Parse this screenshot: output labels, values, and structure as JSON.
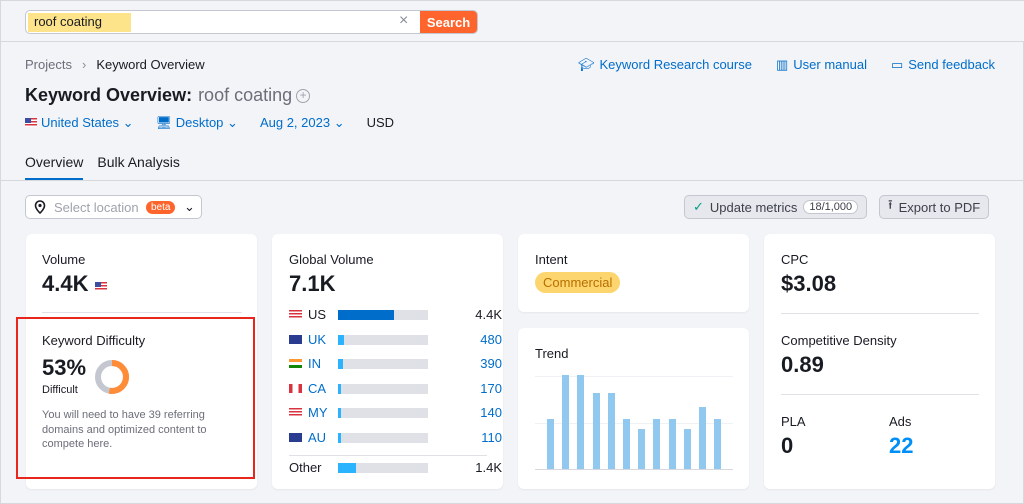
{
  "search": {
    "value": "roof coating",
    "button_label": "Search",
    "clear_icon": "×"
  },
  "breadcrumb": {
    "items": [
      "Projects",
      "Keyword Overview"
    ]
  },
  "header_links": [
    {
      "icon": "graduation-cap-icon",
      "label": "Keyword Research course"
    },
    {
      "icon": "book-icon",
      "label": "User manual"
    },
    {
      "icon": "feedback-icon",
      "label": "Send feedback"
    }
  ],
  "title": {
    "prefix": "Keyword Overview:",
    "keyword": "roof coating"
  },
  "filters": {
    "country": "United States",
    "device": "Desktop",
    "date": "Aug 2, 2023",
    "currency": "USD"
  },
  "tabs": [
    {
      "label": "Overview",
      "active": true
    },
    {
      "label": "Bulk Analysis",
      "active": false
    }
  ],
  "location": {
    "placeholder": "Select location",
    "badge": "beta"
  },
  "actions": {
    "update_label": "Update metrics",
    "update_count": "18/1,000",
    "export_label": "Export to PDF"
  },
  "volume": {
    "label": "Volume",
    "value": "4.4K"
  },
  "keyword_difficulty": {
    "label": "Keyword Difficulty",
    "value": "53%",
    "percent": 53,
    "level": "Difficult",
    "description": "You will need to have 39 referring domains and optimized content to compete here.",
    "colors": {
      "fill": "#ff8c37",
      "track": "#c4c7cf"
    }
  },
  "global_volume": {
    "label": "Global Volume",
    "value": "7.1K",
    "rows": [
      {
        "code": "US",
        "value": "4.4K",
        "fraction": 0.62,
        "color": "#006dca",
        "linked": false
      },
      {
        "code": "UK",
        "value": "480",
        "fraction": 0.07,
        "color": "#2bb3ff",
        "linked": true
      },
      {
        "code": "IN",
        "value": "390",
        "fraction": 0.055,
        "color": "#2bb3ff",
        "linked": true
      },
      {
        "code": "CA",
        "value": "170",
        "fraction": 0.025,
        "color": "#2bb3ff",
        "linked": true
      },
      {
        "code": "MY",
        "value": "140",
        "fraction": 0.02,
        "color": "#2bb3ff",
        "linked": true
      },
      {
        "code": "AU",
        "value": "110",
        "fraction": 0.016,
        "color": "#2bb3ff",
        "linked": true
      }
    ],
    "other": {
      "code": "Other",
      "value": "1.4K",
      "fraction": 0.2,
      "color": "#2bb3ff"
    }
  },
  "intent": {
    "label": "Intent",
    "value": "Commercial"
  },
  "trend": {
    "label": "Trend",
    "values": [
      0.53,
      1.0,
      1.0,
      0.81,
      0.81,
      0.53,
      0.43,
      0.53,
      0.53,
      0.43,
      0.66,
      0.53
    ]
  },
  "cpc": {
    "label": "CPC",
    "value": "$3.08"
  },
  "competitive_density": {
    "label": "Competitive Density",
    "value": "0.89"
  },
  "pla": {
    "label": "PLA",
    "value": "0"
  },
  "ads": {
    "label": "Ads",
    "value": "22"
  }
}
